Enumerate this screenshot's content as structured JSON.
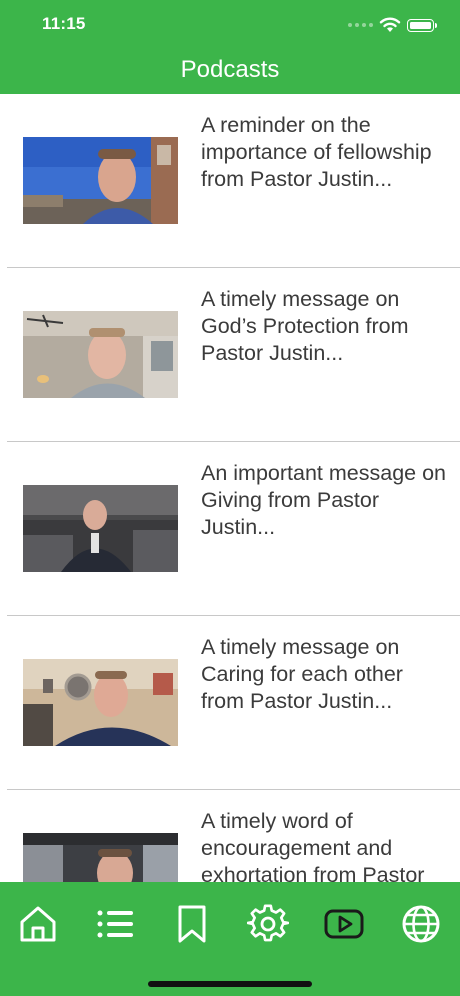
{
  "status_bar": {
    "time": "11:15"
  },
  "header": {
    "title": "Podcasts"
  },
  "podcasts": [
    {
      "title": "A reminder on the importance of fellowship from Pastor Justin..."
    },
    {
      "title": "A timely message on God’s Protection from Pastor Justin..."
    },
    {
      "title": "An important message on Giving from Pastor Justin..."
    },
    {
      "title": "A timely message on Caring for each other from Pastor Justin..."
    },
    {
      "title": "A timely word of encouragement and exhortation from Pastor"
    }
  ],
  "tab_bar": {
    "items": [
      {
        "icon": "home-icon"
      },
      {
        "icon": "list-icon"
      },
      {
        "icon": "bookmark-icon"
      },
      {
        "icon": "gear-icon"
      },
      {
        "icon": "youtube-icon"
      },
      {
        "icon": "globe-icon"
      }
    ]
  },
  "colors": {
    "brand_green": "#3cb54a",
    "text": "#3b3b3b",
    "separator": "#c8c8c8"
  }
}
